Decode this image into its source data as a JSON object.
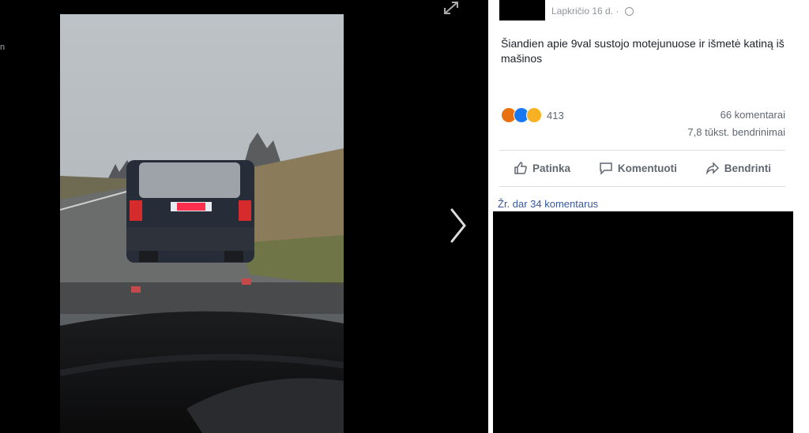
{
  "post": {
    "date": "Lapkričio 16 d. ·",
    "text": "Šiandien apie 9val sustojo motejunuose ir išmetė katiną iš mašinos",
    "reaction_count": "413",
    "comments_count": "66 komentarai",
    "shares_count": "7,8 tūkst. bendrinimai"
  },
  "actions": {
    "like": "Patinka",
    "comment": "Komentuoti",
    "share": "Bendrinti"
  },
  "view_comments": "Žr. dar 34 komentarus",
  "viewer": {
    "side_text": "n",
    "expand_icon": "expand-icon",
    "next_icon": "chevron-right-icon"
  },
  "colors": {
    "link": "#385898",
    "like_blue": "#1877f2",
    "angry_orange": "#e9710f",
    "sad_yellow": "#f7b125"
  }
}
